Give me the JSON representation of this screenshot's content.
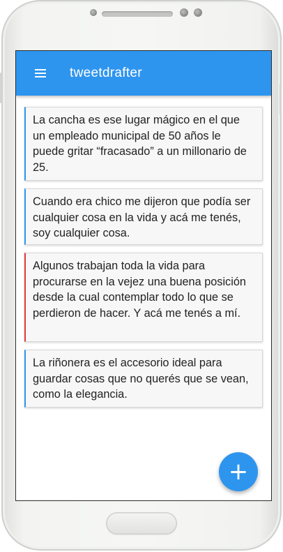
{
  "app": {
    "title": "tweetdrafter"
  },
  "menu_icon": "hamburger-menu-icon",
  "fab": {
    "label": "+",
    "icon": "plus-icon",
    "color": "#2e95ee"
  },
  "colors": {
    "appbar": "#2e95ee",
    "accent_default": "#2e95ee",
    "accent_warning": "#e53935"
  },
  "drafts": [
    {
      "text": "La cancha es ese lugar mágico en el que un empleado municipal de 50 años le puede gritar “fracasado” a un millonario de 25.",
      "status": "ok"
    },
    {
      "text": "Cuando era chico me dijeron que podía ser cualquier cosa en la vida y acá me tenés, soy cualquier cosa.",
      "status": "ok"
    },
    {
      "text": "Algunos trabajan toda la vida para procurarse en la vejez una buena posición desde la cual contemplar todo lo que se perdieron de hacer. Y acá me tenés a mí.",
      "status": "warning"
    },
    {
      "text": "La riñonera es el accesorio ideal para guardar cosas que no querés que se vean, como la elegancia.",
      "status": "ok"
    }
  ]
}
